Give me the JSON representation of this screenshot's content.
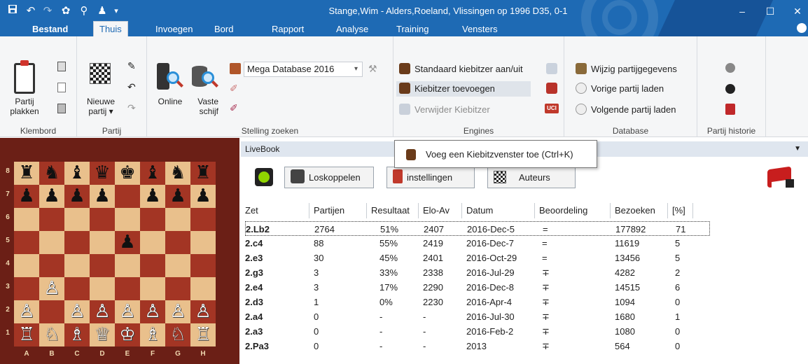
{
  "titlebar": {
    "title": "Stange,Wim - Alders,Roeland, Vlissingen op 1996  D35, 0-1",
    "minimize": "–",
    "maximize": "☐",
    "close": "✕"
  },
  "menu": {
    "tabs": [
      "Bestand",
      "Thuis",
      "Invoegen",
      "Bord",
      "Rapport",
      "Analyse",
      "Training",
      "Vensters"
    ],
    "active": "Thuis"
  },
  "ribbon": {
    "klembord": {
      "label": "Klembord",
      "paste": "Partij\nplakken"
    },
    "partij": {
      "label": "Partij",
      "new": "Nieuwe\npartij ▾"
    },
    "stelling": {
      "label": "Stelling zoeken",
      "online": "Online",
      "vaste": "Vaste\nschijf",
      "database_select": "Mega Database 2016"
    },
    "engines": {
      "label": "Engines",
      "standard": "Standaard kiebitzer aan/uit",
      "add": "Kiebitzer toevoegen",
      "remove": "Verwijder Kiebitzer"
    },
    "database": {
      "label": "Database",
      "edit": "Wijzig partijgegevens",
      "prev": "Vorige partij laden",
      "next": "Volgende partij laden"
    },
    "historie": {
      "label": "Partij historie"
    }
  },
  "board": {
    "ranks": [
      "8",
      "7",
      "6",
      "5",
      "4",
      "3",
      "2",
      "1"
    ],
    "files": [
      "A",
      "B",
      "C",
      "D",
      "E",
      "F",
      "G",
      "H"
    ],
    "rows": [
      [
        "♜",
        "♞",
        "♝",
        "♛",
        "♚",
        "♝",
        "♞",
        "♜"
      ],
      [
        "♟",
        "♟",
        "♟",
        "♟",
        "",
        "♟",
        "♟",
        "♟"
      ],
      [
        "",
        "",
        "",
        "",
        "",
        "",
        "",
        ""
      ],
      [
        "",
        "",
        "",
        "",
        "♟",
        "",
        "",
        ""
      ],
      [
        "",
        "",
        "",
        "",
        "",
        "",
        "",
        ""
      ],
      [
        "",
        "♙",
        "",
        "",
        "",
        "",
        "",
        ""
      ],
      [
        "♙",
        "",
        "♙",
        "♙",
        "♙",
        "♙",
        "♙",
        "♙"
      ],
      [
        "♖",
        "♘",
        "♗",
        "♕",
        "♔",
        "♗",
        "♘",
        "♖"
      ]
    ]
  },
  "livebook": {
    "title": "LiveBook",
    "buttons": {
      "disconnect": "Loskoppelen",
      "settings": "instellingen",
      "authors": "Auteurs"
    },
    "columns": [
      "Zet",
      "Partijen",
      "Resultaat",
      "Elo-Av",
      "Datum",
      "Beoordeling",
      "Bezoeken",
      "[%]"
    ],
    "rows": [
      [
        "2.Lb2",
        "2764",
        "51%",
        "2407",
        "2016-Dec-5",
        "=",
        "177892",
        "71"
      ],
      [
        "2.c4",
        "88",
        "55%",
        "2419",
        "2016-Dec-7",
        "=",
        "11619",
        "5"
      ],
      [
        "2.e3",
        "30",
        "45%",
        "2401",
        "2016-Oct-29",
        "=",
        "13456",
        "5"
      ],
      [
        "2.g3",
        "3",
        "33%",
        "2338",
        "2016-Jul-29",
        "∓",
        "4282",
        "2"
      ],
      [
        "2.e4",
        "3",
        "17%",
        "2290",
        "2016-Dec-8",
        "∓",
        "14515",
        "6"
      ],
      [
        "2.d3",
        "1",
        "0%",
        "2230",
        "2016-Apr-4",
        "∓",
        "1094",
        "0"
      ],
      [
        "2.a4",
        "0",
        "-",
        "-",
        "2016-Jul-30",
        "∓",
        "1680",
        "1"
      ],
      [
        "2.a3",
        "0",
        "-",
        "-",
        "2016-Feb-2",
        "∓",
        "1080",
        "0"
      ],
      [
        "2.Pa3",
        "0",
        "-",
        "-",
        "2013",
        "∓",
        "564",
        "0"
      ]
    ]
  },
  "tooltip": {
    "text": "Voeg een Kiebitzvenster toe (Ctrl+K)"
  }
}
